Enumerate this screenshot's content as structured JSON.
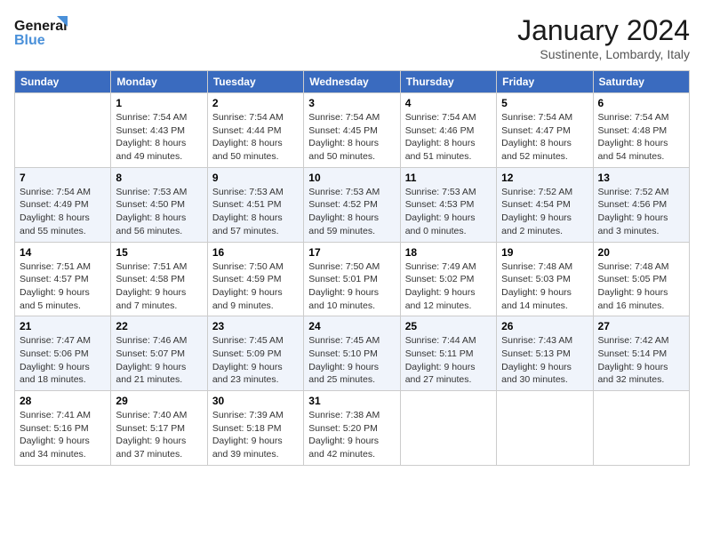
{
  "logo": {
    "line1": "General",
    "line2": "Blue"
  },
  "title": "January 2024",
  "subtitle": "Sustinente, Lombardy, Italy",
  "weekdays": [
    "Sunday",
    "Monday",
    "Tuesday",
    "Wednesday",
    "Thursday",
    "Friday",
    "Saturday"
  ],
  "weeks": [
    [
      {
        "day": "",
        "sunrise": "",
        "sunset": "",
        "daylight": ""
      },
      {
        "day": "1",
        "sunrise": "Sunrise: 7:54 AM",
        "sunset": "Sunset: 4:43 PM",
        "daylight": "Daylight: 8 hours and 49 minutes."
      },
      {
        "day": "2",
        "sunrise": "Sunrise: 7:54 AM",
        "sunset": "Sunset: 4:44 PM",
        "daylight": "Daylight: 8 hours and 50 minutes."
      },
      {
        "day": "3",
        "sunrise": "Sunrise: 7:54 AM",
        "sunset": "Sunset: 4:45 PM",
        "daylight": "Daylight: 8 hours and 50 minutes."
      },
      {
        "day": "4",
        "sunrise": "Sunrise: 7:54 AM",
        "sunset": "Sunset: 4:46 PM",
        "daylight": "Daylight: 8 hours and 51 minutes."
      },
      {
        "day": "5",
        "sunrise": "Sunrise: 7:54 AM",
        "sunset": "Sunset: 4:47 PM",
        "daylight": "Daylight: 8 hours and 52 minutes."
      },
      {
        "day": "6",
        "sunrise": "Sunrise: 7:54 AM",
        "sunset": "Sunset: 4:48 PM",
        "daylight": "Daylight: 8 hours and 54 minutes."
      }
    ],
    [
      {
        "day": "7",
        "sunrise": "Sunrise: 7:54 AM",
        "sunset": "Sunset: 4:49 PM",
        "daylight": "Daylight: 8 hours and 55 minutes."
      },
      {
        "day": "8",
        "sunrise": "Sunrise: 7:53 AM",
        "sunset": "Sunset: 4:50 PM",
        "daylight": "Daylight: 8 hours and 56 minutes."
      },
      {
        "day": "9",
        "sunrise": "Sunrise: 7:53 AM",
        "sunset": "Sunset: 4:51 PM",
        "daylight": "Daylight: 8 hours and 57 minutes."
      },
      {
        "day": "10",
        "sunrise": "Sunrise: 7:53 AM",
        "sunset": "Sunset: 4:52 PM",
        "daylight": "Daylight: 8 hours and 59 minutes."
      },
      {
        "day": "11",
        "sunrise": "Sunrise: 7:53 AM",
        "sunset": "Sunset: 4:53 PM",
        "daylight": "Daylight: 9 hours and 0 minutes."
      },
      {
        "day": "12",
        "sunrise": "Sunrise: 7:52 AM",
        "sunset": "Sunset: 4:54 PM",
        "daylight": "Daylight: 9 hours and 2 minutes."
      },
      {
        "day": "13",
        "sunrise": "Sunrise: 7:52 AM",
        "sunset": "Sunset: 4:56 PM",
        "daylight": "Daylight: 9 hours and 3 minutes."
      }
    ],
    [
      {
        "day": "14",
        "sunrise": "Sunrise: 7:51 AM",
        "sunset": "Sunset: 4:57 PM",
        "daylight": "Daylight: 9 hours and 5 minutes."
      },
      {
        "day": "15",
        "sunrise": "Sunrise: 7:51 AM",
        "sunset": "Sunset: 4:58 PM",
        "daylight": "Daylight: 9 hours and 7 minutes."
      },
      {
        "day": "16",
        "sunrise": "Sunrise: 7:50 AM",
        "sunset": "Sunset: 4:59 PM",
        "daylight": "Daylight: 9 hours and 9 minutes."
      },
      {
        "day": "17",
        "sunrise": "Sunrise: 7:50 AM",
        "sunset": "Sunset: 5:01 PM",
        "daylight": "Daylight: 9 hours and 10 minutes."
      },
      {
        "day": "18",
        "sunrise": "Sunrise: 7:49 AM",
        "sunset": "Sunset: 5:02 PM",
        "daylight": "Daylight: 9 hours and 12 minutes."
      },
      {
        "day": "19",
        "sunrise": "Sunrise: 7:48 AM",
        "sunset": "Sunset: 5:03 PM",
        "daylight": "Daylight: 9 hours and 14 minutes."
      },
      {
        "day": "20",
        "sunrise": "Sunrise: 7:48 AM",
        "sunset": "Sunset: 5:05 PM",
        "daylight": "Daylight: 9 hours and 16 minutes."
      }
    ],
    [
      {
        "day": "21",
        "sunrise": "Sunrise: 7:47 AM",
        "sunset": "Sunset: 5:06 PM",
        "daylight": "Daylight: 9 hours and 18 minutes."
      },
      {
        "day": "22",
        "sunrise": "Sunrise: 7:46 AM",
        "sunset": "Sunset: 5:07 PM",
        "daylight": "Daylight: 9 hours and 21 minutes."
      },
      {
        "day": "23",
        "sunrise": "Sunrise: 7:45 AM",
        "sunset": "Sunset: 5:09 PM",
        "daylight": "Daylight: 9 hours and 23 minutes."
      },
      {
        "day": "24",
        "sunrise": "Sunrise: 7:45 AM",
        "sunset": "Sunset: 5:10 PM",
        "daylight": "Daylight: 9 hours and 25 minutes."
      },
      {
        "day": "25",
        "sunrise": "Sunrise: 7:44 AM",
        "sunset": "Sunset: 5:11 PM",
        "daylight": "Daylight: 9 hours and 27 minutes."
      },
      {
        "day": "26",
        "sunrise": "Sunrise: 7:43 AM",
        "sunset": "Sunset: 5:13 PM",
        "daylight": "Daylight: 9 hours and 30 minutes."
      },
      {
        "day": "27",
        "sunrise": "Sunrise: 7:42 AM",
        "sunset": "Sunset: 5:14 PM",
        "daylight": "Daylight: 9 hours and 32 minutes."
      }
    ],
    [
      {
        "day": "28",
        "sunrise": "Sunrise: 7:41 AM",
        "sunset": "Sunset: 5:16 PM",
        "daylight": "Daylight: 9 hours and 34 minutes."
      },
      {
        "day": "29",
        "sunrise": "Sunrise: 7:40 AM",
        "sunset": "Sunset: 5:17 PM",
        "daylight": "Daylight: 9 hours and 37 minutes."
      },
      {
        "day": "30",
        "sunrise": "Sunrise: 7:39 AM",
        "sunset": "Sunset: 5:18 PM",
        "daylight": "Daylight: 9 hours and 39 minutes."
      },
      {
        "day": "31",
        "sunrise": "Sunrise: 7:38 AM",
        "sunset": "Sunset: 5:20 PM",
        "daylight": "Daylight: 9 hours and 42 minutes."
      },
      {
        "day": "",
        "sunrise": "",
        "sunset": "",
        "daylight": ""
      },
      {
        "day": "",
        "sunrise": "",
        "sunset": "",
        "daylight": ""
      },
      {
        "day": "",
        "sunrise": "",
        "sunset": "",
        "daylight": ""
      }
    ]
  ]
}
